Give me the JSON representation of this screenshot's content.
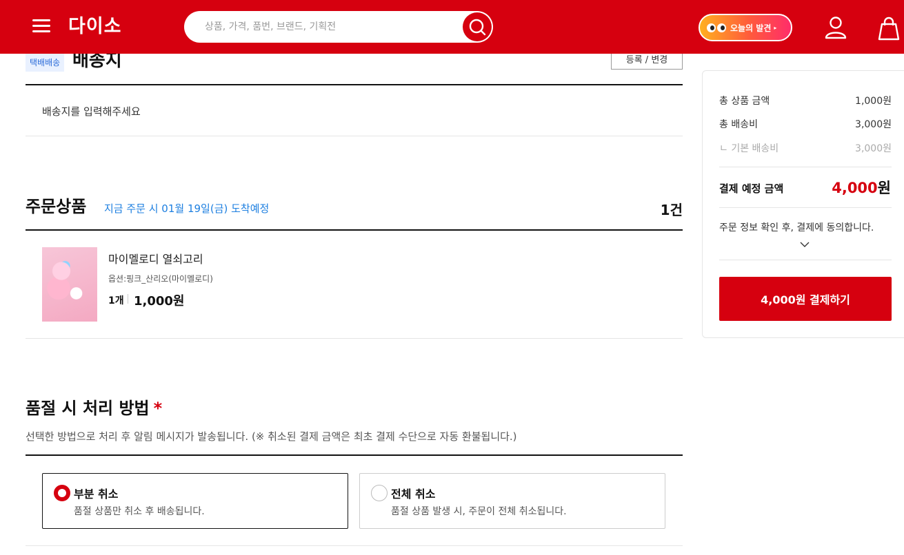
{
  "header": {
    "logo": "다이소",
    "search_placeholder": "상품, 가격, 품번, 브랜드, 기획전",
    "discover_label": "오늘의 발견",
    "discover_arrow": "▸"
  },
  "delivery": {
    "badge": "택배배송",
    "title": "배송지",
    "edit_button": "등록 / 변경",
    "empty_text": "배송지를 입력해주세요"
  },
  "order": {
    "title": "주문상품",
    "arrival": "지금 주문 시 01월 19일(금) 도착예정",
    "count": "1건",
    "product": {
      "name": "마이멜로디 열쇠고리",
      "option": "옵션:핑크_산리오(마이멜로디)",
      "qty": "1개",
      "price": "1,000원"
    }
  },
  "soldout": {
    "title": "품절 시 처리 방법",
    "required_mark": "*",
    "description": "선택한 방법으로 처리 후 알림 메시지가 발송됩니다. (※ 취소된 결제 금액은 최초 결제 수단으로 자동 환불됩니다.)",
    "options": [
      {
        "title": "부분 취소",
        "desc": "품절 상품만 취소 후 배송됩니다.",
        "selected": true
      },
      {
        "title": "전체 취소",
        "desc": "품절 상품 발생 시, 주문이 전체 취소됩니다.",
        "selected": false
      }
    ]
  },
  "summary": {
    "product_total_label": "총 상품 금액",
    "product_total_value": "1,000원",
    "shipping_label": "총 배송비",
    "shipping_value": "3,000원",
    "base_shipping_label": "ㄴ 기본 배송비",
    "base_shipping_value": "3,000원",
    "total_label": "결제 예정 금액",
    "total_amount": "4,000",
    "total_unit": "원",
    "agree_text": "주문 정보 확인 후, 결제에 동의합니다.",
    "pay_button": "4,000원 결제하기"
  },
  "colors": {
    "brand": "#d6000f",
    "link": "#1d7fe0"
  }
}
